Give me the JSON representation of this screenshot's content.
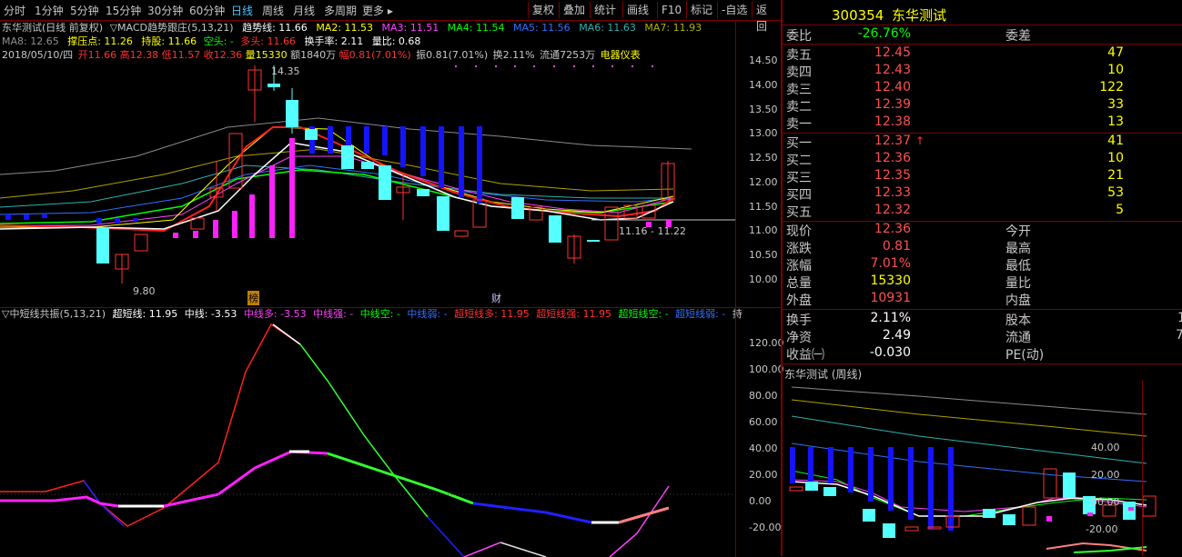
{
  "toolbar": {
    "periods": [
      "分时",
      "1分钟",
      "5分钟",
      "15分钟",
      "30分钟",
      "60分钟",
      "日线",
      "周线",
      "月线",
      "多周期",
      "更多 ▸"
    ],
    "active_period": "日线",
    "actions": [
      "复权",
      "叠加",
      "统计",
      "画线",
      "F10",
      "标记",
      "-自选",
      "返回"
    ]
  },
  "info": {
    "title": "东华测试(日线 前复权)",
    "indicator_name": "▽MACD趋势跟庄(5,13,21)",
    "trend_line": "趋势线: 11.66",
    "ma2": "MA2: 11.53",
    "ma3": "MA3: 11.51",
    "ma4": "MA4: 11.54",
    "ma5": "MA5: 11.56",
    "ma6": "MA6: 11.63",
    "ma7": "MA7: 11.93",
    "ma8": "MA8: 12.65",
    "support": "撑压点: 11.26",
    "hold": "持股: 11.66",
    "kong": "空头: -",
    "duo": "多头: 11.66",
    "turnover": "换手率: 2.11",
    "vol_ratio": "量比: 0.68",
    "date": "2018/05/10/四",
    "open": "开11.66",
    "high": "高12.38",
    "low": "低11.57",
    "close": "收12.36",
    "volume": "量15330",
    "amount": "额1840万",
    "range": "幅0.81(7.01%)",
    "amp": "振0.81(7.01%)",
    "chg": "换2.11%",
    "float": "流通7253万",
    "sector": "电器仪表"
  },
  "markers": {
    "high": "14.35",
    "low": "9.80",
    "last_range": "11.16 - 11.22",
    "bang": "榜",
    "cai": "财"
  },
  "main_axis": [
    "14.50",
    "14.00",
    "13.50",
    "13.00",
    "12.50",
    "12.00",
    "11.50",
    "11.00",
    "10.50",
    "10.00"
  ],
  "sub_info": {
    "title": "▽中短线共振(5,13,21)",
    "super_short": "超短线: 11.95",
    "mid": "中线: -3.53",
    "mid_duo": "中线多: -3.53",
    "mid_strong": "中线强: -",
    "mid_kong": "中线空: -",
    "mid_weak": "中线弱: -",
    "ss_duo": "超短线多: 11.95",
    "ss_strong": "超短线强: 11.95",
    "ss_kong": "超短线空: -",
    "ss_weak": "超短线弱: -",
    "tail": "持"
  },
  "sub_axis": [
    "120.00",
    "100.00",
    "80.00",
    "60.00",
    "40.00",
    "20.00",
    "0.00",
    "-20.00"
  ],
  "quote": {
    "code": "300354",
    "name": "东华测试",
    "weibi_label": "委比",
    "weibi": "-26.76%",
    "weicha_label": "委差",
    "asks": [
      {
        "label": "卖五",
        "price": "12.45",
        "vol": "47"
      },
      {
        "label": "卖四",
        "price": "12.43",
        "vol": "10"
      },
      {
        "label": "卖三",
        "price": "12.40",
        "vol": "122"
      },
      {
        "label": "卖二",
        "price": "12.39",
        "vol": "33"
      },
      {
        "label": "卖一",
        "price": "12.38",
        "vol": "13"
      }
    ],
    "bids": [
      {
        "label": "买一",
        "price": "12.37",
        "vol": "41"
      },
      {
        "label": "买二",
        "price": "12.36",
        "vol": "10"
      },
      {
        "label": "买三",
        "price": "12.35",
        "vol": "21"
      },
      {
        "label": "买四",
        "price": "12.33",
        "vol": "53"
      },
      {
        "label": "买五",
        "price": "12.32",
        "vol": "5"
      }
    ],
    "stats": [
      {
        "l1": "现价",
        "v1": "12.36",
        "l2": "今开"
      },
      {
        "l1": "涨跌",
        "v1": "0.81",
        "l2": "最高"
      },
      {
        "l1": "涨幅",
        "v1": "7.01%",
        "l2": "最低"
      },
      {
        "l1": "总量",
        "v1": "15330",
        "l2": "量比"
      },
      {
        "l1": "外盘",
        "v1": "10931",
        "l2": "内盘"
      }
    ],
    "stats2": [
      {
        "l1": "换手",
        "v1": "2.11%",
        "l2": "股本"
      },
      {
        "l1": "净资",
        "v1": "2.49",
        "l2": "流通"
      },
      {
        "l1": "收益㈠",
        "v1": "-0.030",
        "l2": "PE(动)"
      }
    ],
    "weekly_title": "东华测试 (周线)",
    "weekly_axis": [
      "40.00",
      "20.00",
      "00.00",
      "-20.00"
    ],
    "flow_tail": "7",
    "cap_tail": "1"
  },
  "colors": {
    "up": "#ff3232",
    "down": "#54ffff",
    "bg": "#000000",
    "grid": "#800000"
  }
}
